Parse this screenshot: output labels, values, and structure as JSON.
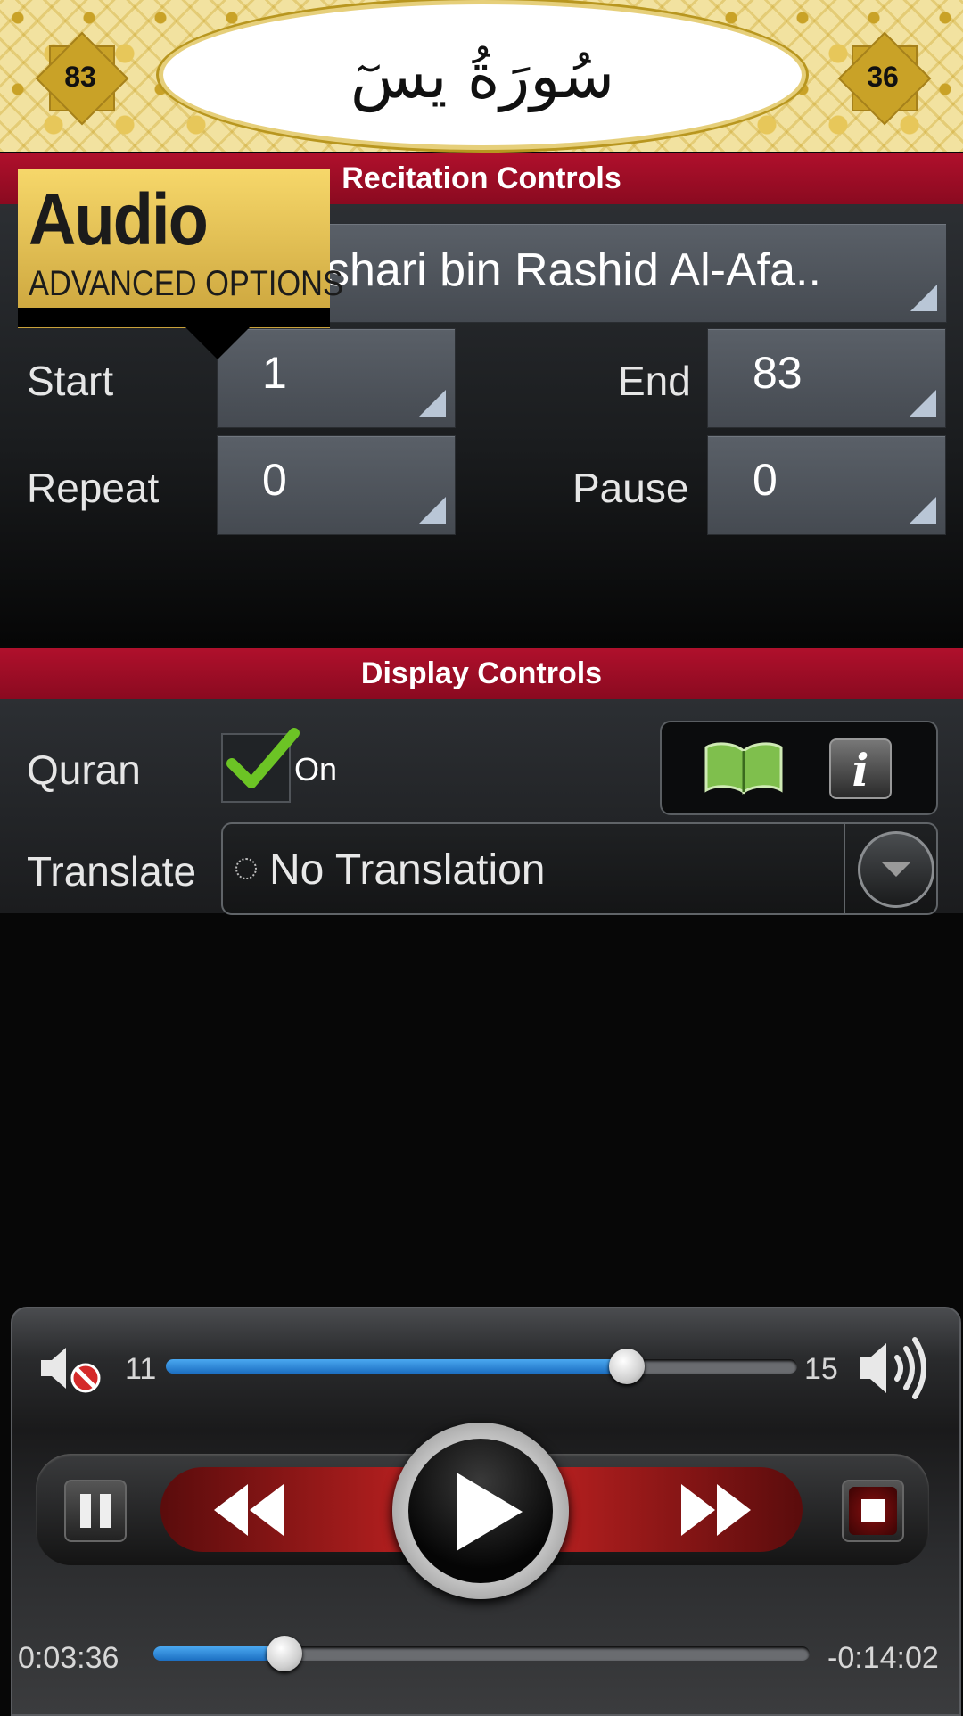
{
  "header": {
    "surah_title": "سُورَةُ يسٓ",
    "left_badge": "83",
    "right_badge": "36"
  },
  "recitation": {
    "section_title": "Recitation Controls",
    "reciter": "shari bin Rashid Al-Afa..",
    "start_label": "Start",
    "start_value": "1",
    "end_label": "End",
    "end_value": "83",
    "repeat_label": "Repeat",
    "repeat_value": "0",
    "pause_label": "Pause",
    "pause_value": "0"
  },
  "tooltip": {
    "title": "Audio",
    "subtitle": "ADVANCED OPTIONS"
  },
  "display": {
    "section_title": "Display Controls",
    "quran_label": "Quran",
    "quran_checked": true,
    "quran_state": "On",
    "translate_label": "Translate",
    "translate_value": "No Translation",
    "icons": [
      "book-icon",
      "info-icon"
    ]
  },
  "player": {
    "volume_min": "11",
    "volume_max": "15",
    "volume_level": 0.73,
    "elapsed": "0:03:36",
    "remaining": "-0:14:02",
    "progress": 0.2,
    "colors": {
      "accent_blue": "#2b86d8",
      "brand_red": "#a00c26",
      "gold": "#e6c75a"
    }
  }
}
